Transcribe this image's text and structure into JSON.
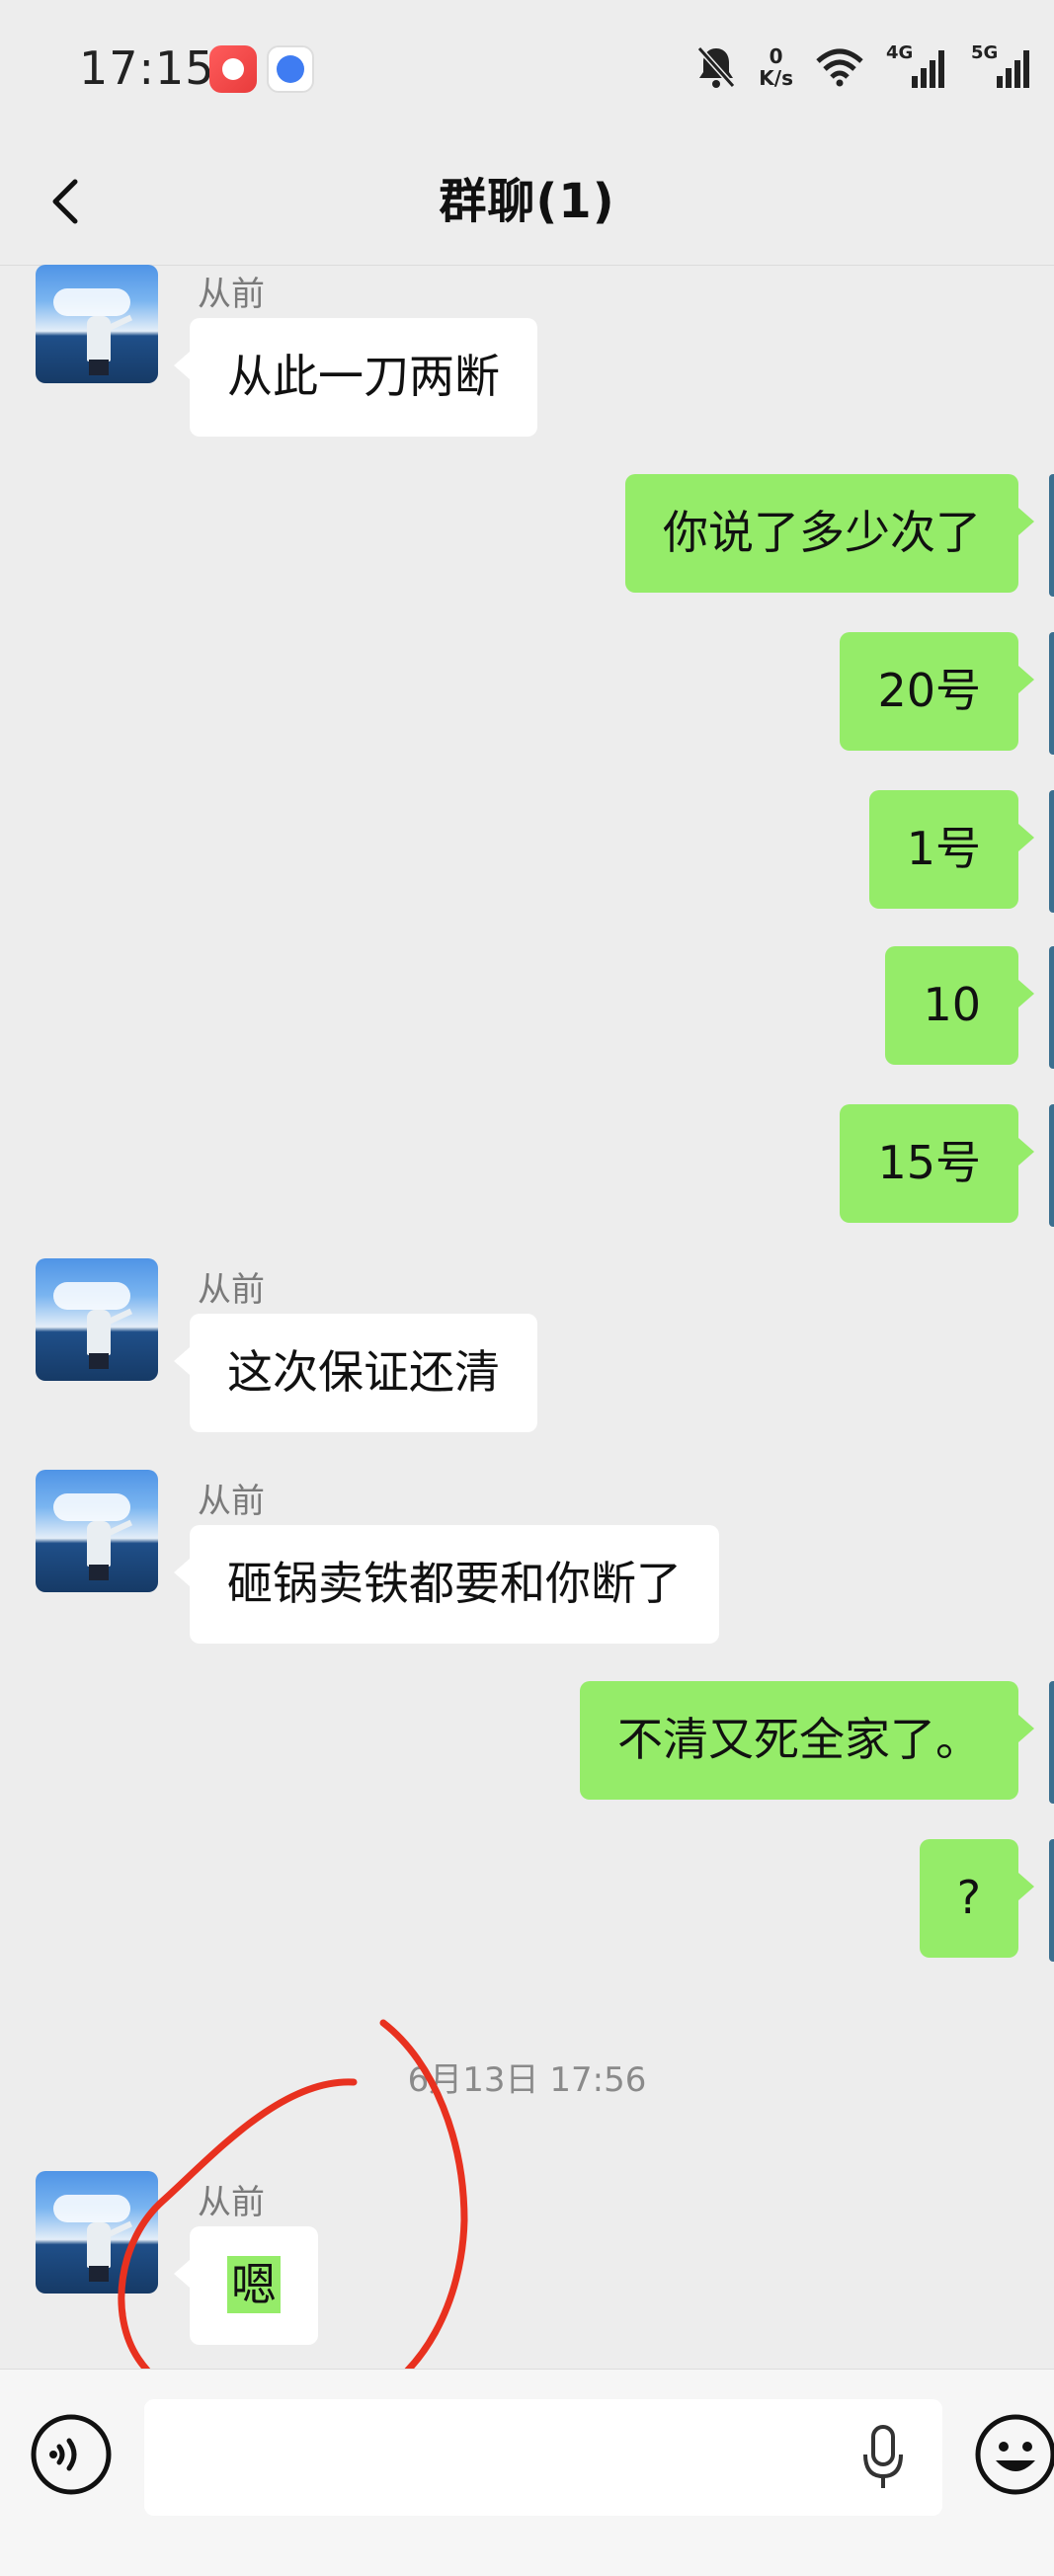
{
  "status_bar": {
    "time": "17:15",
    "net_speed_value": "0",
    "net_speed_unit": "K/s",
    "signal_1_label": "4G",
    "signal_2_label": "5G"
  },
  "header": {
    "title": "群聊(1)"
  },
  "messages": [
    {
      "side": "in",
      "sender": "从前",
      "text": "从此一刀两断"
    },
    {
      "side": "out",
      "text": "你说了多少次了"
    },
    {
      "side": "out",
      "text": "20号"
    },
    {
      "side": "out",
      "text": "1号"
    },
    {
      "side": "out",
      "text": "10"
    },
    {
      "side": "out",
      "text": "15号"
    },
    {
      "side": "in",
      "sender": "从前",
      "text": "这次保证还清"
    },
    {
      "side": "in",
      "sender": "从前",
      "text": "砸锅卖铁都要和你断了"
    },
    {
      "side": "out",
      "text": "不清又死全家了。"
    },
    {
      "side": "out",
      "text": "?"
    },
    {
      "side": "in",
      "sender": "从前",
      "text": "嗯"
    }
  ],
  "timestamp": "6月13日 17:56",
  "colors": {
    "background": "#ededed",
    "incoming_bubble": "#ffffff",
    "outgoing_bubble": "#95ec69",
    "annotation_circle": "#e8311f"
  },
  "input_bar": {
    "voice_icon": "voice-icon",
    "mic_icon": "microphone-icon",
    "emoji_icon": "emoji-icon"
  }
}
